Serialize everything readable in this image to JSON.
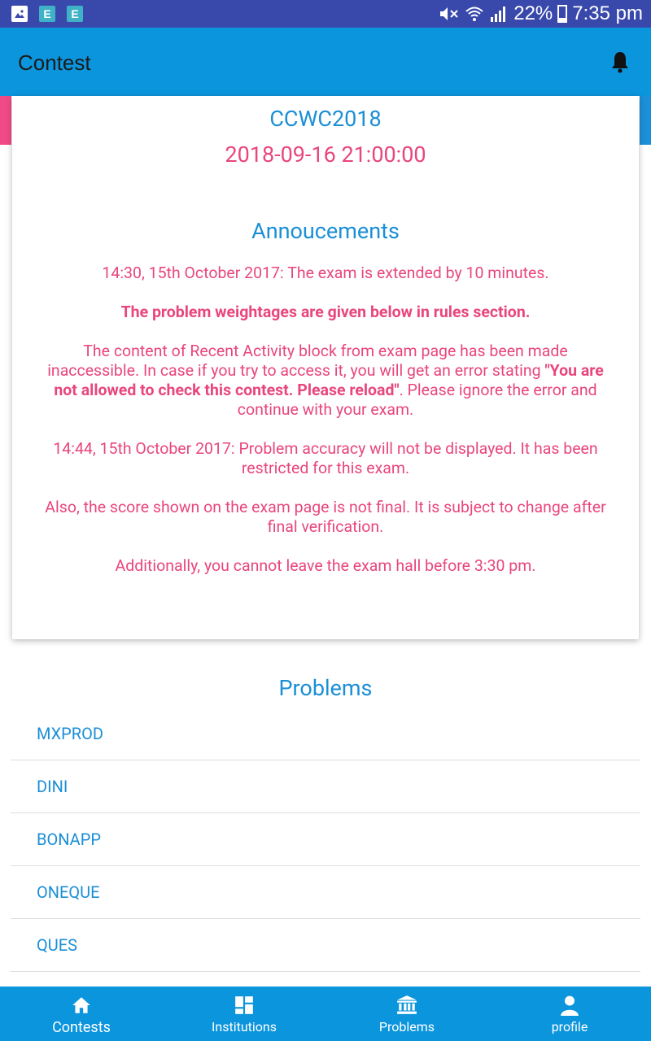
{
  "status_bar": {
    "notification_icons": [
      "image-icon",
      "e-app-icon",
      "e-app-icon"
    ],
    "app_icon_letter": "E",
    "battery": "22%",
    "time": "7:35 pm"
  },
  "appbar": {
    "title": "Contest"
  },
  "contest": {
    "name": "CCWC2018",
    "datetime": "2018-09-16 21:00:00"
  },
  "announcements": {
    "title": "Annoucements",
    "p1": "14:30, 15th October 2017: The exam is extended by 10 minutes.",
    "p2": "The problem weightages are given below in rules section.",
    "p3_a": "The content of Recent Activity block from exam page has been made inaccessible. In case if you try to access it, you will get an error stating ",
    "p3_b": "\"You are not allowed to check this contest. Please reload\"",
    "p3_c": ". Please ignore the error and continue with your exam.",
    "p4": "14:44, 15th October 2017: Problem accuracy will not be displayed. It has been restricted for this exam.",
    "p5": "Also, the score shown on the exam page is not final. It is subject to change after final verification.",
    "p6": "Additionally, you cannot leave the exam hall before 3:30 pm."
  },
  "problems": {
    "title": "Problems",
    "items": [
      "MXPROD",
      "DINI",
      "BONAPP",
      "ONEQUE",
      "QUES"
    ]
  },
  "bottom_nav": [
    {
      "label": "Contests",
      "icon": "home-icon"
    },
    {
      "label": "Institutions",
      "icon": "dashboard-icon"
    },
    {
      "label": "Problems",
      "icon": "bank-icon"
    },
    {
      "label": "profile",
      "icon": "person-icon"
    }
  ],
  "colors": {
    "statusbar": "#3949ab",
    "primary": "#0b95dd",
    "accent_blue": "#1b8fd6",
    "accent_pink": "#e8467d"
  }
}
